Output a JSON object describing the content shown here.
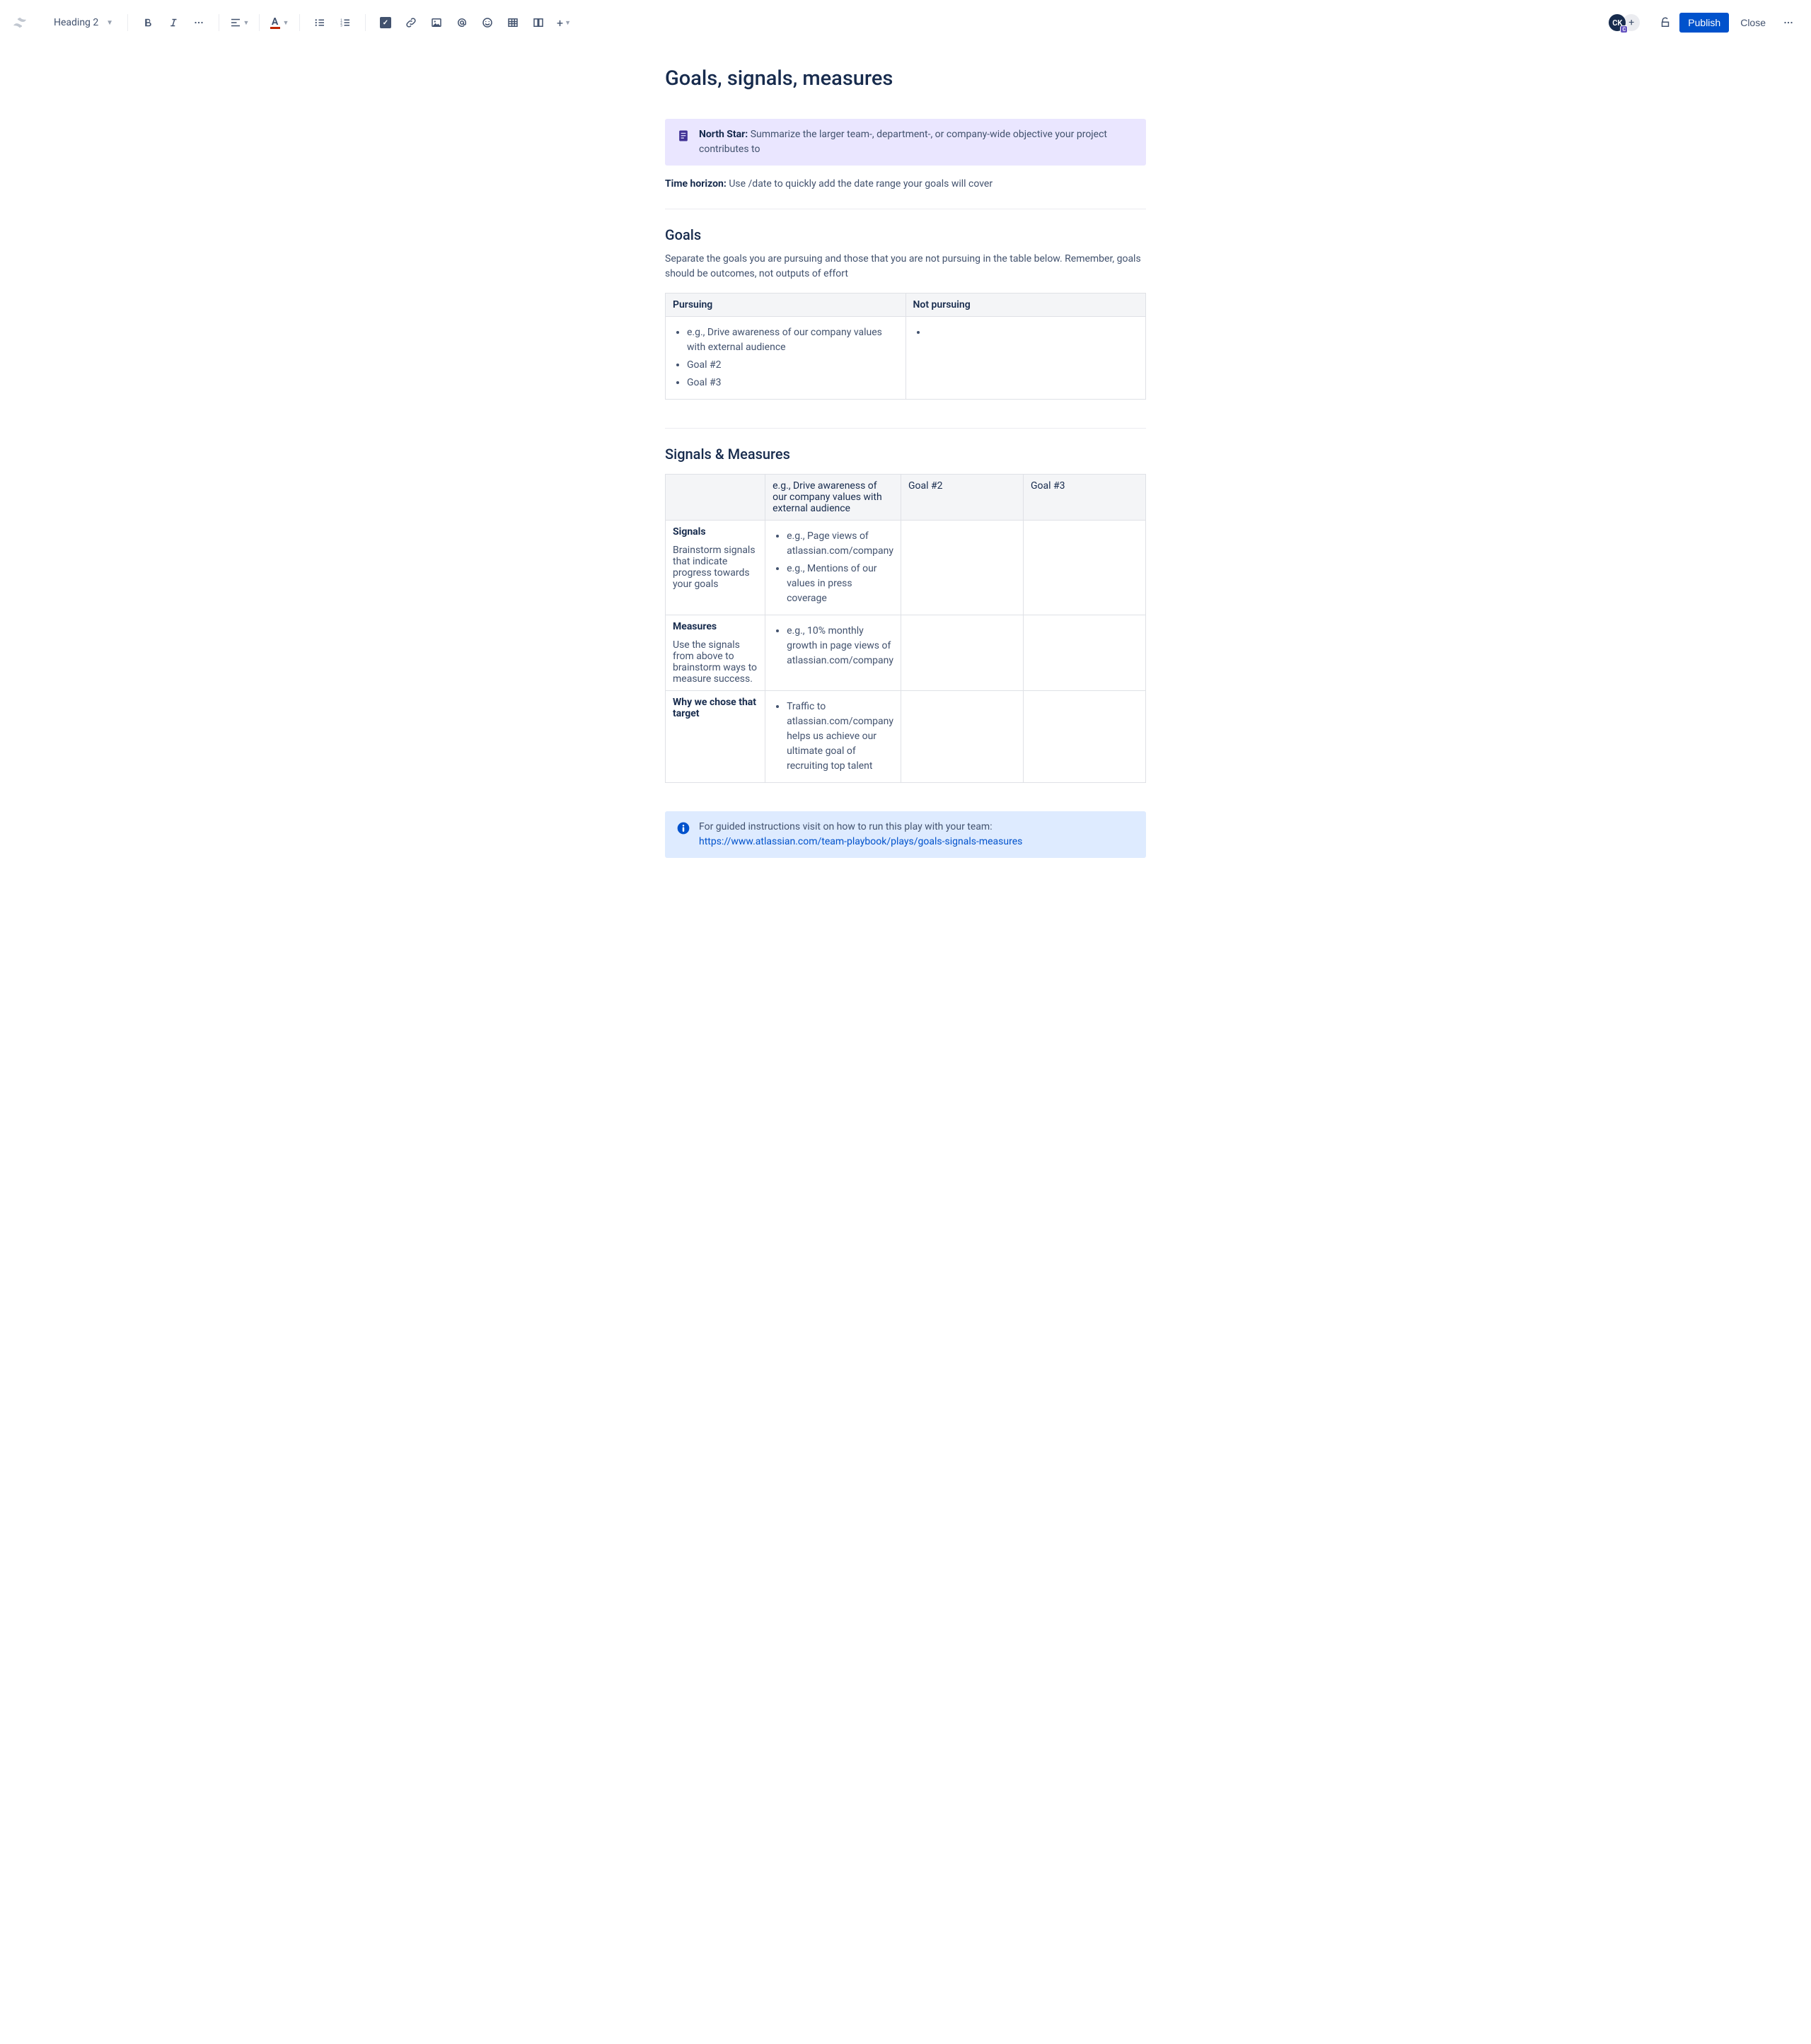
{
  "toolbar": {
    "heading_selector": "Heading 2",
    "publish_label": "Publish",
    "close_label": "Close",
    "avatar_initials": "CK",
    "avatar_badge": "C"
  },
  "page": {
    "title": "Goals, signals, measures",
    "north_star_label": "North Star:",
    "north_star_text": " Summarize the larger team-, department-, or company-wide objective your project contributes to",
    "time_horizon_label": "Time horizon:",
    "time_horizon_text": " Use /date to quickly add the date range your goals will cover",
    "goals_heading": "Goals",
    "goals_desc": "Separate the goals you are pursuing and those that you are not pursuing in the table below. Remember, goals should be outcomes, not outputs of effort",
    "goals_table": {
      "col1": "Pursuing",
      "col2": "Not pursuing",
      "pursuing_items": {
        "i0": "e.g., Drive awareness of our company values with external audience",
        "i1": "Goal #2",
        "i2": "Goal #3"
      }
    },
    "signals_heading": "Signals & Measures",
    "signals_table": {
      "header": {
        "c1": "e.g., Drive awareness of our company values with external audience",
        "c2": "Goal #2",
        "c3": "Goal #3"
      },
      "row_signals_label": "Signals",
      "row_signals_desc": "Brainstorm signals that indicate progress towards your goals",
      "row_signals_items": {
        "i0": "e.g., Page views of atlassian.com/company",
        "i1": "e.g., Mentions of our values in press coverage"
      },
      "row_measures_label": "Measures",
      "row_measures_desc": "Use the signals from above to brainstorm ways to measure success.",
      "row_measures_items": {
        "i0": "e.g., 10% monthly growth in page views of atlassian.com/company"
      },
      "row_why_label": "Why we chose that target",
      "row_why_items": {
        "i0": "Traffic to atlassian.com/company helps us achieve our ultimate goal of recruiting top talent"
      }
    },
    "info_text": "For guided instructions visit on how to run this play with your team: ",
    "info_link": "https://www.atlassian.com/team-playbook/plays/goals-signals-measures"
  }
}
